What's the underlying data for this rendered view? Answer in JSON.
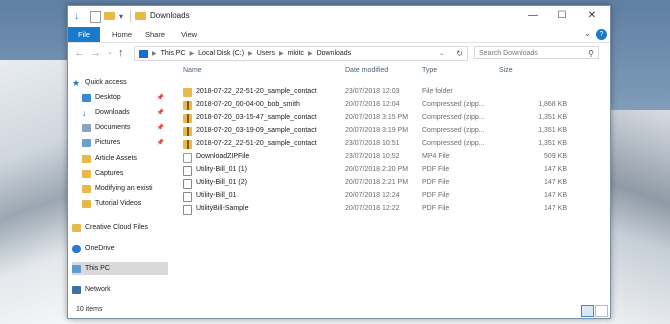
{
  "window": {
    "title": "Downloads",
    "minimize_icon": "minimize-icon",
    "maximize_icon": "maximize-icon",
    "close_icon": "close-icon"
  },
  "ribbon": {
    "tabs": [
      "File",
      "Home",
      "Share",
      "View"
    ],
    "help": "?"
  },
  "address": {
    "crumbs": [
      "This PC",
      "Local Disk (C:)",
      "Users",
      "mkitc",
      "Downloads"
    ]
  },
  "search": {
    "placeholder": "Search Downloads"
  },
  "sidebar": {
    "items": [
      {
        "label": "Quick access",
        "icon": "star-icon"
      },
      {
        "label": "Desktop",
        "icon": "desktop-icon",
        "pinned": true
      },
      {
        "label": "Downloads",
        "icon": "download-icon",
        "pinned": true
      },
      {
        "label": "Documents",
        "icon": "documents-icon",
        "pinned": true
      },
      {
        "label": "Pictures",
        "icon": "pictures-icon",
        "pinned": true
      },
      {
        "label": "Article Assets",
        "icon": "folder-icon"
      },
      {
        "label": "Captures",
        "icon": "folder-icon"
      },
      {
        "label": "Modifying an existi",
        "icon": "folder-icon"
      },
      {
        "label": "Tutorial Videos",
        "icon": "folder-icon"
      },
      {
        "label": "Creative Cloud Files",
        "icon": "folder-icon"
      },
      {
        "label": "OneDrive",
        "icon": "cloud-icon"
      },
      {
        "label": "This PC",
        "icon": "computer-icon",
        "selected": true
      },
      {
        "label": "Network",
        "icon": "network-icon"
      }
    ]
  },
  "columns": [
    "Name",
    "Date modified",
    "Type",
    "Size"
  ],
  "files": [
    {
      "name": "2018-07-22_22-51-20_sample_contact",
      "date": "23/07/2018 12:03",
      "type": "File folder",
      "size": "",
      "icon": "folder-icon"
    },
    {
      "name": "2018-07-20_00-04-00_bob_smith",
      "date": "20/07/2018 12:04",
      "type": "Compressed (zipp...",
      "size": "1,868 KB",
      "icon": "zip-icon"
    },
    {
      "name": "2018-07-20_03-15-47_sample_contact",
      "date": "20/07/2018 3:15 PM",
      "type": "Compressed (zipp...",
      "size": "1,351 KB",
      "icon": "zip-icon"
    },
    {
      "name": "2018-07-20_03-19-09_sample_contact",
      "date": "20/07/2018 3:19 PM",
      "type": "Compressed (zipp...",
      "size": "1,351 KB",
      "icon": "zip-icon"
    },
    {
      "name": "2018-07-22_22-51-20_sample_contact",
      "date": "23/07/2018 10:51",
      "type": "Compressed (zipp...",
      "size": "1,351 KB",
      "icon": "zip-icon"
    },
    {
      "name": "DownloadZIPFile",
      "date": "23/07/2018 10:52",
      "type": "MP4 File",
      "size": "509 KB",
      "icon": "video-icon"
    },
    {
      "name": "Utility-Bill_01 (1)",
      "date": "20/07/2018 2:20 PM",
      "type": "PDF File",
      "size": "147 KB",
      "icon": "pdf-icon"
    },
    {
      "name": "Utility-Bill_01 (2)",
      "date": "20/07/2018 2:21 PM",
      "type": "PDF File",
      "size": "147 KB",
      "icon": "pdf-icon"
    },
    {
      "name": "Utility-Bill_01",
      "date": "20/07/2018 12:24",
      "type": "PDF File",
      "size": "147 KB",
      "icon": "pdf-icon"
    },
    {
      "name": "UtilityBill-Sample",
      "date": "20/07/2018 12:22",
      "type": "PDF File",
      "size": "147 KB",
      "icon": "pdf-icon"
    }
  ],
  "status": {
    "count": "10 items"
  },
  "colors": {
    "accent": "#1979ca",
    "folder": "#e8b94a",
    "selected": "#d9d9d9"
  }
}
